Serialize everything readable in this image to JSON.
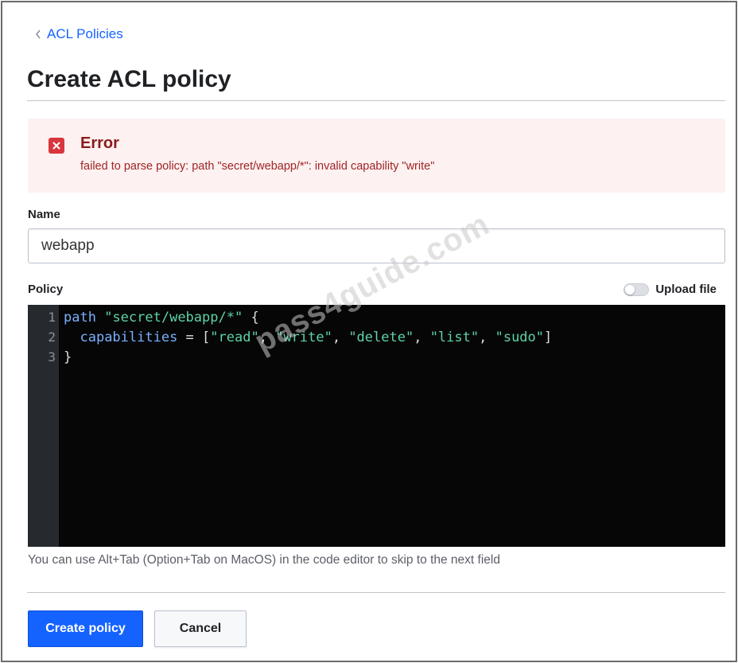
{
  "breadcrumb": {
    "label": "ACL Policies"
  },
  "page": {
    "title": "Create ACL policy"
  },
  "error": {
    "title": "Error",
    "message": "failed to parse policy: path \"secret/webapp/*\": invalid capability \"write\""
  },
  "form": {
    "name_label": "Name",
    "name_value": "webapp",
    "policy_label": "Policy",
    "upload_label": "Upload file",
    "upload_enabled": false,
    "hint": "You can use Alt+Tab (Option+Tab on MacOS) in the code editor to skip to the next field"
  },
  "editor": {
    "line_numbers": [
      "1",
      "2",
      "3"
    ],
    "lines": [
      "path \"secret/webapp/*\" {",
      "  capabilities = [\"read\", \"write\", \"delete\", \"list\", \"sudo\"]",
      "}"
    ]
  },
  "actions": {
    "create_label": "Create policy",
    "cancel_label": "Cancel"
  },
  "watermark": "pass4guide.com",
  "colors": {
    "accent": "#1563ff",
    "error_bg": "#fdf1f1",
    "error_icon": "#d9363e",
    "editor_bg": "#060606"
  }
}
